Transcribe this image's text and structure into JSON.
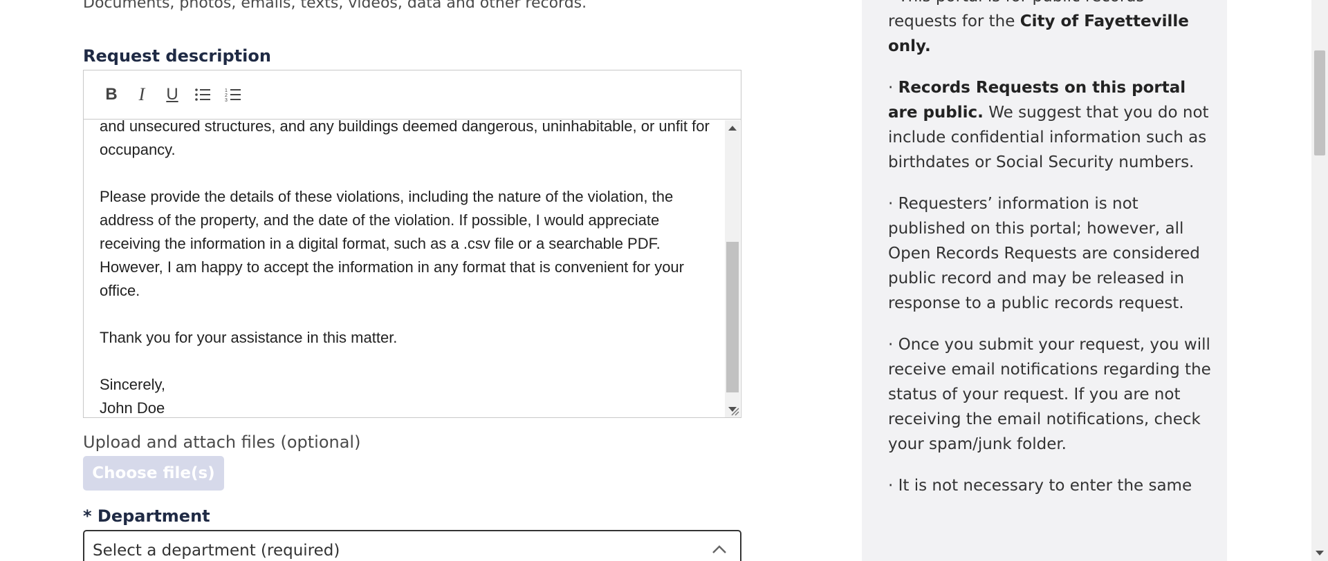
{
  "form": {
    "hint": "Documents, photos, emails, texts, videos, data and other records.",
    "description_label": "Request description",
    "toolbar": {
      "bold": "B",
      "italic": "I",
      "underline": "U"
    },
    "description_lines": [
      "and unsecured structures, and any buildings deemed dangerous, uninhabitable, or unfit for occupancy.",
      "Please provide the details of these violations, including the nature of the violation, the address of the property, and the date of the violation. If possible, I would appreciate receiving the information in a digital format, such as a .csv file or a searchable PDF. However, I am happy to accept the information in any format that is convenient for your office.",
      "Thank you for your assistance in this matter.",
      "Sincerely,",
      "John Doe"
    ],
    "upload_label": "Upload and attach files (optional)",
    "choose_files": "Choose file(s)",
    "department_label": "* Department",
    "department_placeholder": "Select a department (required)"
  },
  "sidebar": {
    "p1_pre": "· This portal is for public records requests for the ",
    "p1_bold": "City of Fayetteville only.",
    "p2_bold": "Records Requests on this portal are public.",
    "p2_rest": " We suggest that you do not include confidential information such as birthdates or Social Security numbers.",
    "p3": "· Requesters’ information is not published on this portal; however, all Open Records Requests are considered public record and may be released in response to a public records request.",
    "p4": "· Once you submit your request, you will receive email notifications regarding the status of your request. If you are not receiving the email notifications, check your spam/junk folder.",
    "p5": "· It is not necessary to enter the same"
  }
}
